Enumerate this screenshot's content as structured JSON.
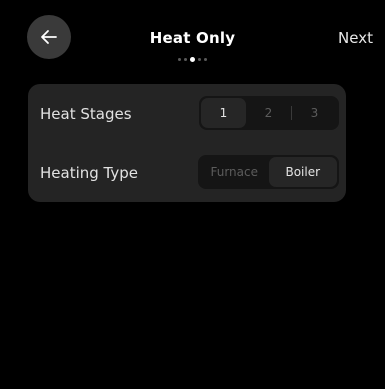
{
  "header": {
    "back_icon": "arrow-left-icon",
    "title": "Heat Only",
    "next_label": "Next"
  },
  "pager": {
    "total": 5,
    "active_index": 2
  },
  "settings": {
    "heat_stages": {
      "label": "Heat Stages",
      "options": [
        "1",
        "2",
        "3"
      ],
      "selected": "1"
    },
    "heating_type": {
      "label": "Heating Type",
      "options": [
        "Furnace",
        "Boiler"
      ],
      "selected": "Boiler"
    }
  },
  "colors": {
    "background": "#000000",
    "panel": "#242424",
    "segment_track": "#151515",
    "segment_active": "#262626",
    "back_button": "#3a3a3a"
  }
}
